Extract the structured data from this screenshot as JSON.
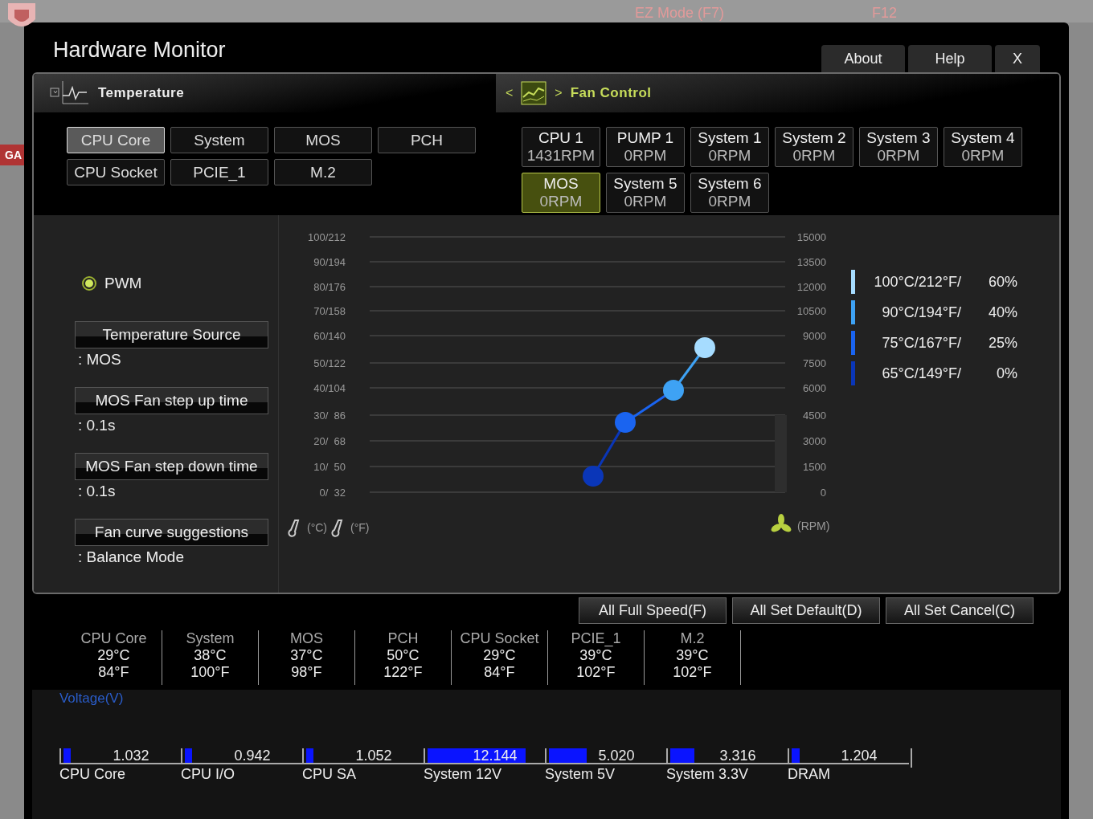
{
  "background": {
    "mode_button": "EZ Mode (F7)",
    "hotkey": "F12",
    "side_label": "GA"
  },
  "window": {
    "title": "Hardware Monitor",
    "buttons": [
      {
        "label": "About"
      },
      {
        "label": "Help"
      },
      {
        "label": "X"
      }
    ]
  },
  "temperature": {
    "title": "Temperature",
    "sensors": [
      {
        "label": "CPU Core",
        "selected": true
      },
      {
        "label": "System",
        "selected": false
      },
      {
        "label": "MOS",
        "selected": false
      },
      {
        "label": "PCH",
        "selected": false
      },
      {
        "label": "CPU Socket",
        "selected": false
      },
      {
        "label": "PCIE_1",
        "selected": false
      },
      {
        "label": "M.2",
        "selected": false
      }
    ]
  },
  "fan_control": {
    "title": "Fan Control",
    "prev": "<",
    "next": ">",
    "fans": [
      {
        "name": "CPU 1",
        "speed": "1431RPM",
        "selected": false
      },
      {
        "name": "PUMP 1",
        "speed": "0RPM",
        "selected": false
      },
      {
        "name": "System 1",
        "speed": "0RPM",
        "selected": false
      },
      {
        "name": "System 2",
        "speed": "0RPM",
        "selected": false
      },
      {
        "name": "System 3",
        "speed": "0RPM",
        "selected": false
      },
      {
        "name": "System 4",
        "speed": "0RPM",
        "selected": false
      },
      {
        "name": "MOS",
        "speed": "0RPM",
        "selected": true
      },
      {
        "name": "System 5",
        "speed": "0RPM",
        "selected": false
      },
      {
        "name": "System 6",
        "speed": "0RPM",
        "selected": false
      }
    ]
  },
  "fan_settings": {
    "mode": {
      "label": "PWM",
      "selected": true
    },
    "settings": [
      {
        "label": "Temperature Source",
        "value": ": MOS"
      },
      {
        "label": "MOS Fan step up time",
        "value": ": 0.1s"
      },
      {
        "label": "MOS Fan step down time",
        "value": ": 0.1s"
      },
      {
        "label": "Fan curve suggestions",
        "value": ": Balance Mode"
      }
    ]
  },
  "curve": {
    "temp_ticks": [
      "100/212",
      "90/194",
      "80/176",
      "70/158",
      "60/140",
      "50/122",
      "40/104",
      "30/  86",
      "20/  68",
      "10/  50",
      "0/  32"
    ],
    "rpm_ticks": [
      "15000",
      "13500",
      "12000",
      "10500",
      "9000",
      "7500",
      "6000",
      "4500",
      "3000",
      "1500",
      "0"
    ],
    "celsius_unit": "(°C)",
    "fahrenheit_unit": "(°F)",
    "rpm_unit": "(RPM)",
    "points": [
      {
        "label": "100°C/212°F/",
        "duty": "60%",
        "color": "#a6dcff"
      },
      {
        "label": "90°C/194°F/",
        "duty": "40%",
        "color": "#3ea2f4"
      },
      {
        "label": "75°C/167°F/",
        "duty": "25%",
        "color": "#1a64f0"
      },
      {
        "label": "65°C/149°F/",
        "duty": "0%",
        "color": "#0a36b8"
      }
    ]
  },
  "actions": [
    "All Full Speed(F)",
    "All Set Default(D)",
    "All Set Cancel(C)"
  ],
  "readings": [
    {
      "name": "CPU Core",
      "celsius": "29°C",
      "fahrenheit": "84°F"
    },
    {
      "name": "System",
      "celsius": "38°C",
      "fahrenheit": "100°F"
    },
    {
      "name": "MOS",
      "celsius": "37°C",
      "fahrenheit": "98°F"
    },
    {
      "name": "PCH",
      "celsius": "50°C",
      "fahrenheit": "122°F"
    },
    {
      "name": "CPU Socket",
      "celsius": "29°C",
      "fahrenheit": "84°F"
    },
    {
      "name": "PCIE_1",
      "celsius": "39°C",
      "fahrenheit": "102°F"
    },
    {
      "name": "M.2",
      "celsius": "39°C",
      "fahrenheit": "102°F"
    }
  ],
  "voltage": {
    "title": "Voltage(V)",
    "rails": [
      {
        "name": "CPU Core",
        "value": "1.032",
        "level": 0.06
      },
      {
        "name": "CPU I/O",
        "value": "0.942",
        "level": 0.06
      },
      {
        "name": "CPU SA",
        "value": "1.052",
        "level": 0.06
      },
      {
        "name": "System 12V",
        "value": "12.144",
        "level": 0.85
      },
      {
        "name": "System 5V",
        "value": "5.020",
        "level": 0.33
      },
      {
        "name": "System 3.3V",
        "value": "3.316",
        "level": 0.21
      },
      {
        "name": "DRAM",
        "value": "1.204",
        "level": 0.07
      }
    ]
  }
}
